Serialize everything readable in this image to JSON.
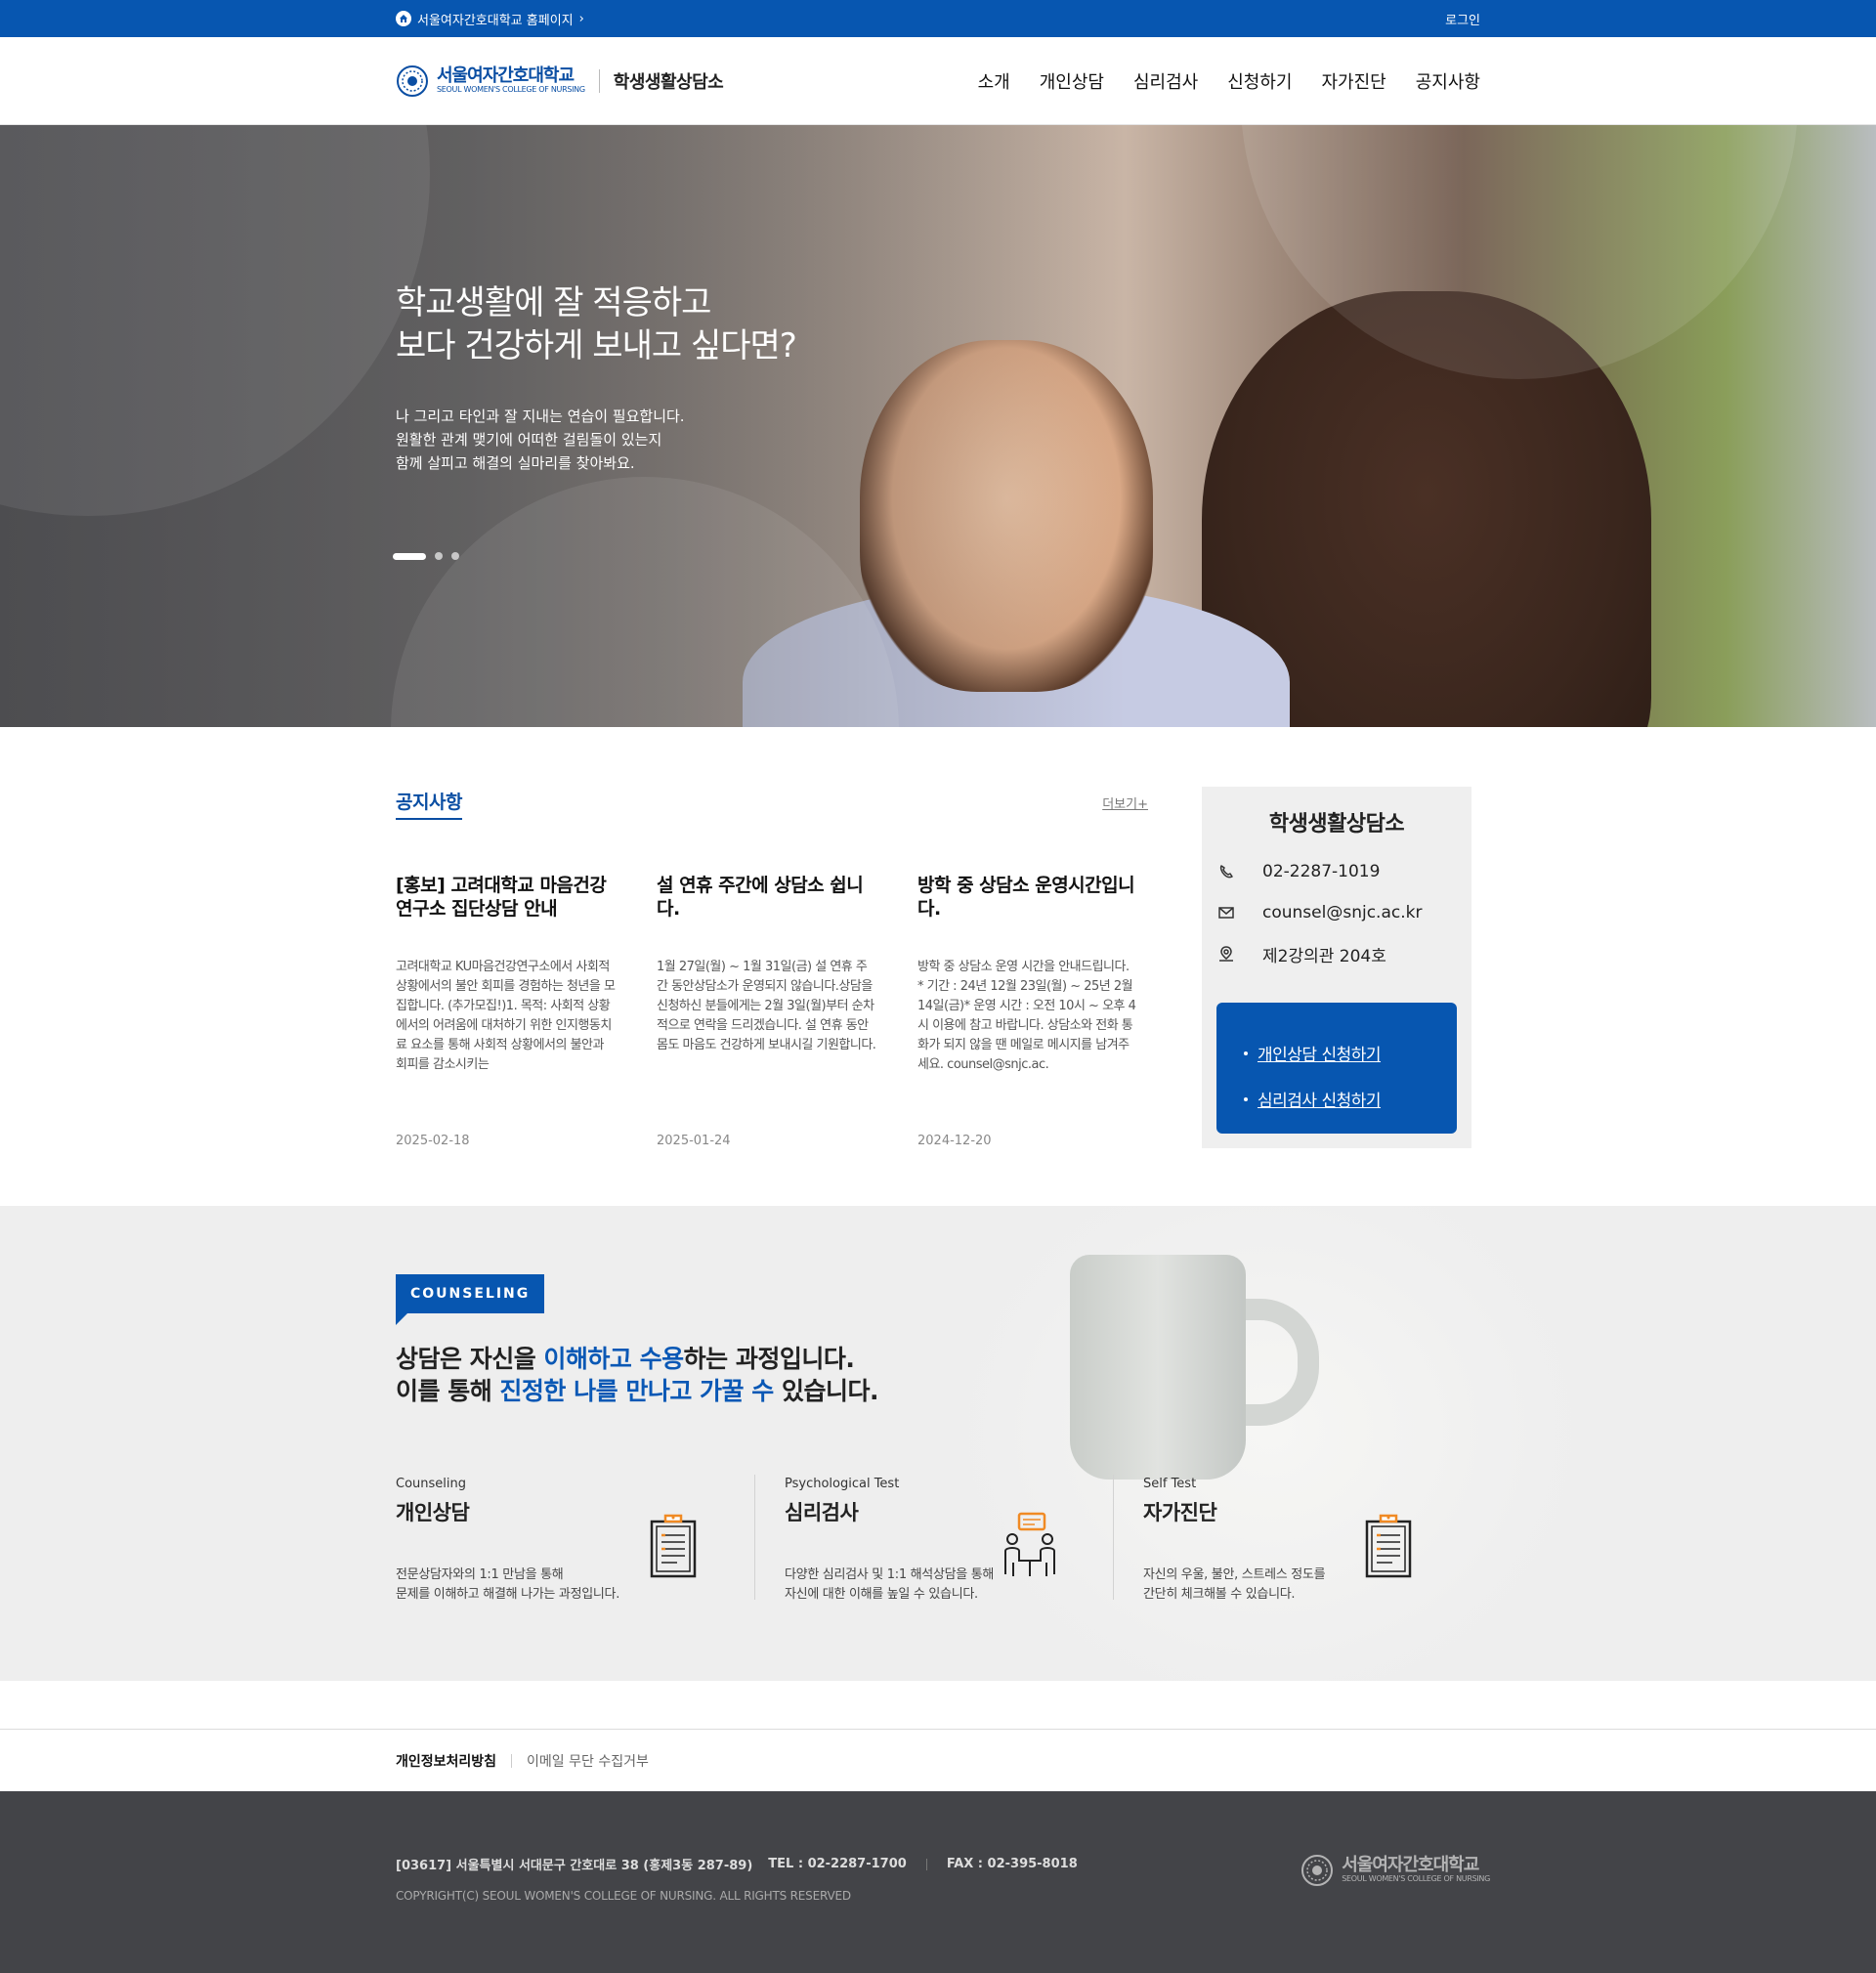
{
  "topbar": {
    "home_link": "서울여자간호대학교 홈페이지",
    "login": "로그인"
  },
  "header": {
    "logo_ko": "서울여자간호대학교",
    "logo_en": "SEOUL WOMEN'S COLLEGE OF NURSING",
    "site_name": "학생생활상담소",
    "nav": [
      "소개",
      "개인상담",
      "심리검사",
      "신청하기",
      "자가진단",
      "공지사항"
    ]
  },
  "hero": {
    "title_lines": [
      "학교생활에 잘 적응하고",
      "보다 건강하게 보내고 싶다면?"
    ],
    "desc_lines": [
      "나 그리고 타인과 잘 지내는 연습이 필요합니다.",
      "원활한 관계 맺기에 어떠한 걸림돌이 있는지",
      "함께 살피고 해결의 실마리를 찾아봐요."
    ],
    "slides_total": 3,
    "slide_active": 1
  },
  "notices": {
    "title": "공지사항",
    "more": "더보기+",
    "items": [
      {
        "title": "[홍보] 고려대학교 마음건강연구소 집단상담 안내",
        "body": "고려대학교 KU마음건강연구소에서 사회적 상황에서의 불안 회피를 경험하는 청년을 모집합니다. (추가모집!)1. 목적: 사회적 상황에서의 어려움에 대처하기 위한 인지행동치료 요소를 통해 사회적 상황에서의 불안과 회피를 감소시키는",
        "date": "2025-02-18"
      },
      {
        "title": "설 연휴 주간에 상담소 쉽니다.",
        "body": "1월 27일(월) ~ 1월 31일(금) 설 연휴 주간 동안상담소가 운영되지 않습니다.상담을 신청하신 분들에게는 2월 3일(월)부터 순차적으로 연락을 드리겠습니다. 설 연휴 동안 몸도 마음도 건강하게 보내시길 기원합니다.",
        "date": "2025-01-24"
      },
      {
        "title": "방학 중 상담소 운영시간입니다.",
        "body": "방학 중 상담소 운영 시간을 안내드립니다. * 기간 : 24년 12월 23일(월) ~ 25년 2월 14일(금)* 운영 시간 : 오전 10시 ~ 오후 4시 이용에 참고 바랍니다. 상담소와 전화 통화가 되지 않을 땐 메일로 메시지를 남겨주세요. counsel@snjc.ac.",
        "date": "2024-12-20"
      }
    ]
  },
  "info": {
    "title": "학생생활상담소",
    "phone": "02-2287-1019",
    "email": "counsel@snjc.ac.kr",
    "location": "제2강의관 204호",
    "apply": [
      "개인상담 신청하기",
      "심리검사 신청하기"
    ]
  },
  "counseling": {
    "badge": "COUNSELING",
    "line1": {
      "a": "상담은 자신을 ",
      "hl": "이해하고 수용",
      "b": "하는 과정입니다."
    },
    "line2": {
      "a": "이를 통해 ",
      "hl": "진정한 나를 만나고 가꿀 수",
      "b": " 있습니다."
    },
    "cards": [
      {
        "en": "Counseling",
        "ko": "개인상담",
        "desc_lines": [
          "전문상담자와의 1:1 만남을 통해",
          "문제를 이해하고 해결해 나가는 과정입니다."
        ],
        "icon": "clipboard-icon"
      },
      {
        "en": "Psychological Test",
        "ko": "심리검사",
        "desc_lines": [
          "다양한 심리검사 및 1:1 해석상담을 통해",
          "자신에 대한 이해를 높일 수 있습니다."
        ],
        "icon": "conversation-icon"
      },
      {
        "en": "Self Test",
        "ko": "자가진단",
        "desc_lines": [
          "자신의 우울, 불안, 스트레스 정도를",
          "간단히 체크해볼 수 있습니다."
        ],
        "icon": "clipboard-icon"
      }
    ],
    "accent": "#f08a24"
  },
  "footer": {
    "privacy": "개인정보처리방침",
    "email_refuse": "이메일 무단 수집거부",
    "address": "[03617] 서울특별시 서대문구 간호대로 38 (홍제3동 287-89)",
    "tel": "TEL : 02-2287-1700",
    "fax": "FAX : 02-395-8018",
    "copyright": "COPYRIGHT(C) SEOUL WOMEN'S COLLEGE OF NURSING. ALL RIGHTS RESERVED"
  },
  "colors": {
    "primary": "#0756b0",
    "footer_bg": "#434448",
    "section_bg": "#eeeeee"
  }
}
